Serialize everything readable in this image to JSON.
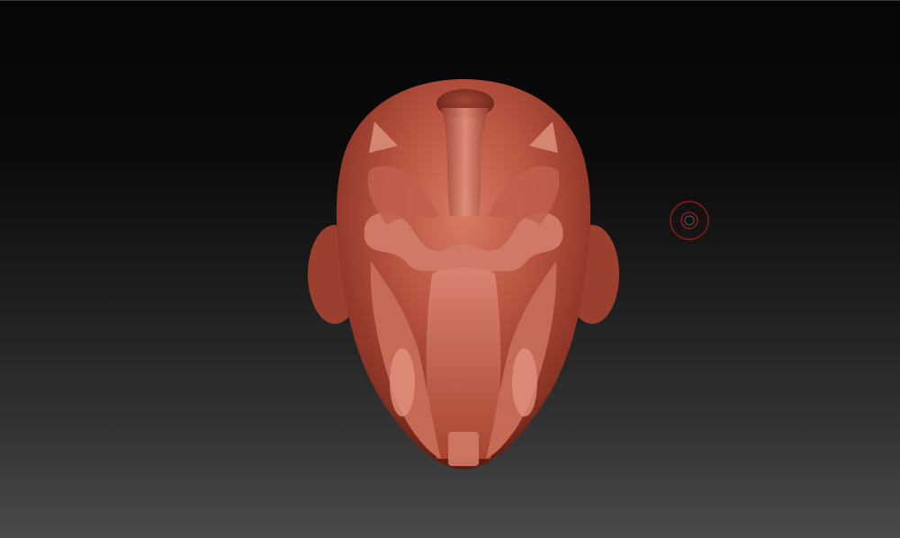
{
  "app": {
    "view": "sculpt-canvas"
  },
  "canvas": {
    "background_top": "#050505",
    "background_bottom": "#4a4a4a"
  },
  "model": {
    "material_color": "#b8533f",
    "shadow_color": "#5a1a10",
    "highlight_color": "#e08a76"
  },
  "brush": {
    "ring_color": "#8a1c1c"
  }
}
